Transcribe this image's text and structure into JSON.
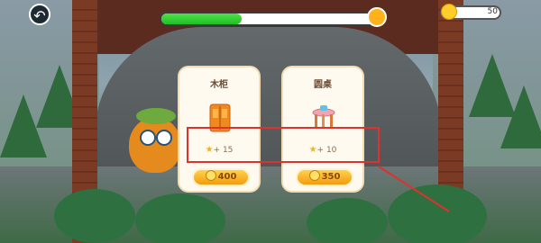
{
  "hud": {
    "back_icon": "arrow-left-icon",
    "progress_fraction": 0.37,
    "reward_icon": "reward-chest-icon",
    "coins": "50"
  },
  "cards": [
    {
      "title": "木柜",
      "item_icon": "wardrobe-icon",
      "gain": "+ 15",
      "price": "400"
    },
    {
      "title": "圆桌",
      "item_icon": "round-table-icon",
      "gain": "+ 10",
      "price": "350"
    }
  ],
  "annotation": {
    "color": "#e0312f"
  },
  "colors": {
    "progress_fill": "#2fcf2f",
    "price_button": "#f6b32b",
    "card_bg": "#fffaf0"
  }
}
